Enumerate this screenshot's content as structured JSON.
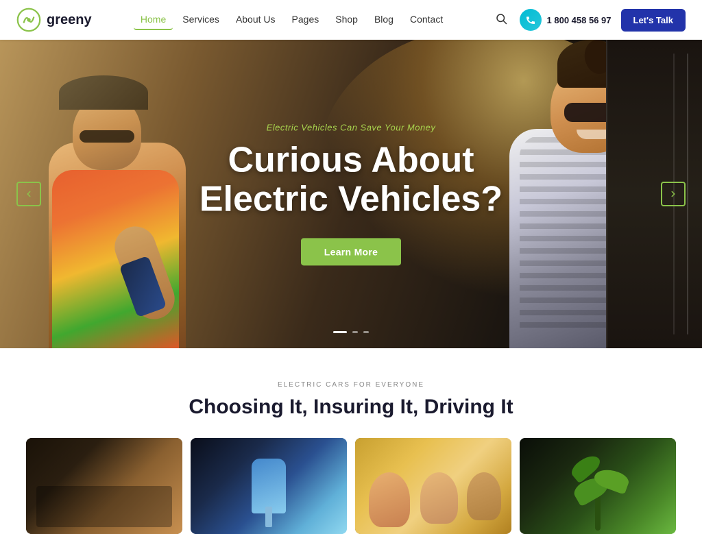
{
  "logo": {
    "text": "greeny",
    "icon_alt": "greeny logo"
  },
  "nav": {
    "items": [
      {
        "label": "Home",
        "active": true
      },
      {
        "label": "Services"
      },
      {
        "label": "About Us"
      },
      {
        "label": "Pages"
      },
      {
        "label": "Shop"
      },
      {
        "label": "Blog"
      },
      {
        "label": "Contact"
      }
    ]
  },
  "header": {
    "phone": "1 800 458 56 97",
    "cta_label": "Let's Talk",
    "search_label": "Search"
  },
  "hero": {
    "subtitle": "Electric Vehicles Can Save Your Money",
    "title_line1": "Curious About",
    "title_line2": "Electric Vehicles?",
    "learn_btn": "Learn More",
    "arrow_left": "←",
    "arrow_right": "→",
    "dots": [
      {
        "active": true
      },
      {
        "active": false
      },
      {
        "active": false
      }
    ]
  },
  "section": {
    "label": "ELECTRIC CARS FOR EVERYONE",
    "title": "Choosing It, Insuring It, Driving It"
  },
  "cards": [
    {
      "alt": "Car interior",
      "color": "card-img-1"
    },
    {
      "alt": "EV charging",
      "color": "card-img-2"
    },
    {
      "alt": "Happy family",
      "color": "card-img-3"
    },
    {
      "alt": "Green plant",
      "color": "card-img-4"
    }
  ]
}
